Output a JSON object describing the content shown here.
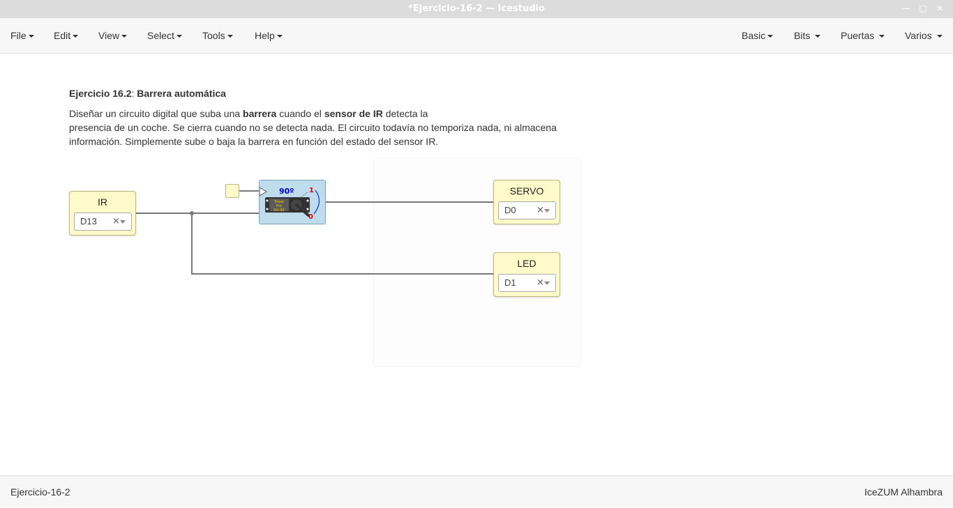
{
  "window": {
    "title": "*Ejercicio-16-2 — Icestudio",
    "controls": [
      "minimize-icon",
      "maximize-icon",
      "close-icon"
    ]
  },
  "menubar": {
    "left": [
      "File",
      "Edit",
      "View",
      "Select",
      "Tools",
      "Help"
    ],
    "right": [
      "Basic",
      "Bits",
      "Puertas",
      "Varios"
    ]
  },
  "info": {
    "heading_bold": "Ejercicio 16.2",
    "heading_sep": ": ",
    "heading_title": "Barrera automática",
    "p1_a": "Diseñar un circuito digital que suba una ",
    "p1_b": "barrera",
    "p1_c": " cuando el ",
    "p1_d": "sensor de IR",
    "p1_e": " detecta la",
    "p2": "presencia de un coche. Se cierra cuando no se detecta nada. El circuito todavía no temporiza nada, ni almacena",
    "p3": "información. Simplemente sube o baja la barrera en función del estado del sensor IR."
  },
  "blocks": {
    "ir": {
      "label": "IR",
      "pin": "D13",
      "clear": "×"
    },
    "servo": {
      "label": "SERVO",
      "pin": "D0",
      "clear": "×"
    },
    "led": {
      "label": "LED",
      "pin": "D1",
      "clear": "×"
    },
    "servo_module": {
      "angle": "90º",
      "one": "1",
      "zero": "0",
      "brand1": "Tower",
      "brand2": "Pro",
      "brand3": "SG-90"
    }
  },
  "colors": {
    "io_block_bg": "#fffac9",
    "servo_block_bg": "#bfdcec",
    "wire": "#777777",
    "angle_text": "#0000cc",
    "bit_text": "#dd0000"
  },
  "footer": {
    "left": "Ejercicio-16-2",
    "right": "IceZUM Alhambra"
  }
}
